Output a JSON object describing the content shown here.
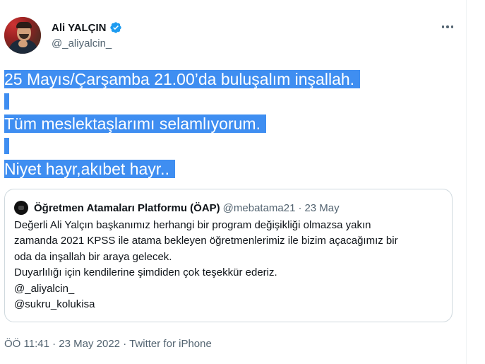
{
  "author": {
    "name": "Ali YALÇIN",
    "handle": "@_aliyalcin_",
    "verified": true,
    "avatar_icon": "profile-photo"
  },
  "more_icon": "more-horizontal-icon",
  "tweet": {
    "line1": "25 Mayıs/Çarşamba 21.00’da buluşalım inşallah.",
    "line2": "Tüm meslektaşlarımı selamlıyorum.",
    "line3": "Niyet hayr,akıbet hayr..",
    "selection_color": "#3f8ef1"
  },
  "quoted_tweet": {
    "name": "Öğretmen Atamaları Platformu (ÖAP)",
    "handle": "@mebatama21",
    "separator": "·",
    "date": "23 May",
    "lines": [
      "Değerli Ali Yalçın başkanımız herhangi bir program değişikliği olmazsa yakın",
      "zamanda 2021 KPSS ile atama bekleyen öğretmenlerimiz ile  bizim açacağımız bir",
      "oda da inşallah bir araya gelecek.",
      "Duyarlılığı için kendilerine şimdiden çok teşekkür ederiz.",
      "@_aliyalcin_",
      "@sukru_kolukisa"
    ]
  },
  "footer": {
    "time": "ÖÖ 11:41",
    "sep1": "·",
    "date": "23 May 2022",
    "sep2": "·",
    "source": "Twitter for iPhone"
  },
  "colors": {
    "verified_blue": "#1d9bf0",
    "secondary_text": "#536471",
    "border": "#cfd9de"
  }
}
